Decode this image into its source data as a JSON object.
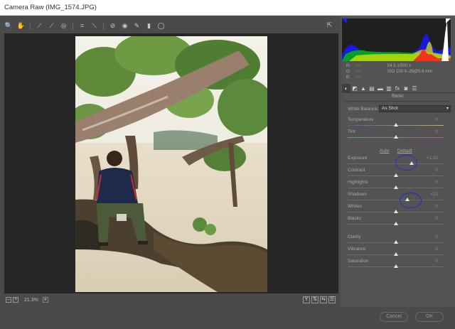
{
  "window": {
    "title": "Camera Raw (IMG_1574.JPG)"
  },
  "toolbar": {
    "tools": [
      {
        "name": "zoom-tool-icon",
        "glyph": "🔍"
      },
      {
        "name": "hand-tool-icon",
        "glyph": "✋"
      },
      {
        "name": "white-balance-tool-icon",
        "glyph": "⟋"
      },
      {
        "name": "color-sampler-tool-icon",
        "glyph": "⟋"
      },
      {
        "name": "targeted-adjustment-tool-icon",
        "glyph": "◎"
      },
      {
        "name": "crop-tool-icon",
        "glyph": "⌗"
      },
      {
        "name": "straighten-tool-icon",
        "glyph": "⟍"
      },
      {
        "name": "spot-removal-tool-icon",
        "glyph": "⊘"
      },
      {
        "name": "red-eye-tool-icon",
        "glyph": "◉"
      },
      {
        "name": "adjustment-brush-icon",
        "glyph": "✎"
      },
      {
        "name": "graduated-filter-icon",
        "glyph": "▮"
      },
      {
        "name": "radial-filter-icon",
        "glyph": "◯"
      }
    ],
    "open_preferences_glyph": "⇱"
  },
  "bottom_bar": {
    "zoom_out_glyph": "–",
    "zoom_in_glyph": "+",
    "zoom_value": "21.3%",
    "zoom_dropdown_glyph": "▾",
    "view_buttons": [
      {
        "name": "before-after-y-icon",
        "glyph": "Y"
      },
      {
        "name": "swap-before-after-icon",
        "glyph": "⇅"
      },
      {
        "name": "copy-settings-icon",
        "glyph": "⇆"
      },
      {
        "name": "toggle-settings-icon",
        "glyph": "☰"
      }
    ]
  },
  "info": {
    "r_label": "R:",
    "g_label": "G:",
    "b_label": "B:",
    "r_value": "---",
    "g_value": "---",
    "b_value": "---",
    "aperture_shutter": "f/4.5   1/500 s",
    "iso_focal": "ISO 100   6–35@5.8 mm"
  },
  "panel_tabs": [
    {
      "name": "basic-tab-icon",
      "glyph": "◐"
    },
    {
      "name": "tone-curve-tab-icon",
      "glyph": "◩"
    },
    {
      "name": "detail-tab-icon",
      "glyph": "▲"
    },
    {
      "name": "hsl-tab-icon",
      "glyph": "▤"
    },
    {
      "name": "split-toning-tab-icon",
      "glyph": "▬"
    },
    {
      "name": "lens-corrections-tab-icon",
      "glyph": "▥"
    },
    {
      "name": "effects-tab-icon",
      "glyph": "fx"
    },
    {
      "name": "camera-calibration-tab-icon",
      "glyph": "◙"
    },
    {
      "name": "presets-tab-icon",
      "glyph": "☰"
    }
  ],
  "panel": {
    "section_title": "Basic",
    "white_balance_label": "White Balance:",
    "white_balance_value": "As Shot",
    "auto_label": "Auto",
    "default_label": "Default"
  },
  "sliders": [
    {
      "id": "temperature",
      "label": "Temperature",
      "value": "0",
      "level": 0.5
    },
    {
      "id": "tint",
      "label": "Tint",
      "value": "0",
      "level": 0.5
    },
    {
      "id": "exposure",
      "label": "Exposure",
      "value": "+1.35",
      "level": 0.67
    },
    {
      "id": "contrast",
      "label": "Contrast",
      "value": "0",
      "level": 0.5
    },
    {
      "id": "highlights",
      "label": "Highlights",
      "value": "0",
      "level": 0.5
    },
    {
      "id": "shadows",
      "label": "Shadows",
      "value": "+23",
      "level": 0.62
    },
    {
      "id": "whites",
      "label": "Whites",
      "value": "0",
      "level": 0.5
    },
    {
      "id": "blacks",
      "label": "Blacks",
      "value": "0",
      "level": 0.5
    },
    {
      "id": "clarity",
      "label": "Clarity",
      "value": "0",
      "level": 0.5
    },
    {
      "id": "vibrance",
      "label": "Vibrance",
      "value": "0",
      "level": 0.5
    },
    {
      "id": "saturation",
      "label": "Saturation",
      "value": "0",
      "level": 0.5
    }
  ],
  "buttons": {
    "cancel": "Cancel",
    "ok": "OK"
  },
  "colors": {
    "annotation_circle": "#1e2adc",
    "panel_bg": "#535353",
    "preview_bg": "#262626"
  }
}
